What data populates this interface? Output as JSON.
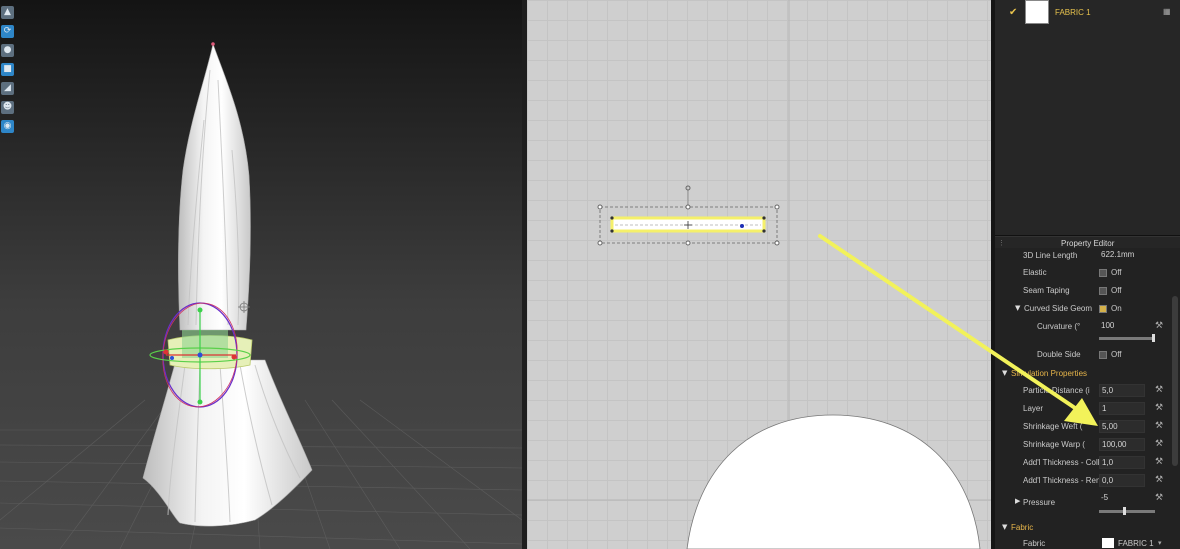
{
  "toolbar3d": {
    "icons": [
      "garment-icon",
      "simulation-icon",
      "avatar-icon",
      "fabric-icon",
      "brush-icon",
      "avatar-view-icon",
      "globe-icon"
    ]
  },
  "object_browser": {
    "fabric_name": "FABRIC 1"
  },
  "property_editor": {
    "title": "Property Editor",
    "rows": {
      "line_length": {
        "label": "3D Line Length",
        "value": "622.1mm"
      },
      "elastic": {
        "label": "Elastic",
        "state": "Off"
      },
      "seam_taping": {
        "label": "Seam Taping",
        "state": "Off"
      },
      "curved_side": {
        "label": "Curved Side Geom",
        "state": "On"
      },
      "curvature": {
        "label": "Curvature (°",
        "value": "100",
        "level": 1.0
      },
      "double_side": {
        "label": "Double Side",
        "state": "Off"
      }
    },
    "simulation": {
      "title": "Simulation Properties",
      "particle_distance": {
        "label": "Particle Distance (i",
        "value": "5,0"
      },
      "layer": {
        "label": "Layer",
        "value": "1"
      },
      "shrinkage_weft": {
        "label": "Shrinkage Weft (",
        "value": "5,00"
      },
      "shrinkage_warp": {
        "label": "Shrinkage Warp (",
        "value": "100,00"
      },
      "thickness_collision": {
        "label": "Add'l Thickness - Coll",
        "value": "1,0"
      },
      "thickness_render": {
        "label": "Add'l Thickness - Ren",
        "value": "0,0"
      },
      "pressure": {
        "label": "Pressure",
        "value": "-5",
        "level": 0.45
      }
    },
    "fabric_section": {
      "title": "Fabric",
      "label": "Fabric",
      "value": "FABRIC 1"
    }
  },
  "colors": {
    "accent": "#e7b54a",
    "annotation_arrow": "#f2f25a",
    "selected_line": "#f5f06a"
  }
}
